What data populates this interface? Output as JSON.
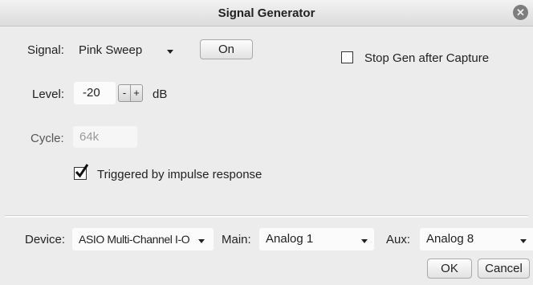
{
  "window": {
    "title": "Signal Generator"
  },
  "signal": {
    "label": "Signal:",
    "value": "Pink Sweep",
    "on_button": "On"
  },
  "stop_gen": {
    "label": "Stop Gen after Capture",
    "checked": false
  },
  "level": {
    "label": "Level:",
    "value": "-20",
    "decrement": "-",
    "increment": "+",
    "unit": "dB"
  },
  "cycle": {
    "label": "Cycle:",
    "value": "64k"
  },
  "triggered": {
    "label": "Triggered by impulse response",
    "checked": true
  },
  "device": {
    "label": "Device:",
    "value": "ASIO Multi-Channel I-O"
  },
  "main": {
    "label": "Main:",
    "value": "Analog 1"
  },
  "aux": {
    "label": "Aux:",
    "value": "Analog 8"
  },
  "buttons": {
    "ok": "OK",
    "cancel": "Cancel"
  },
  "icons": {
    "close": "close-icon",
    "dropdown": "chevron-down-icon",
    "check": "checkmark-icon"
  }
}
